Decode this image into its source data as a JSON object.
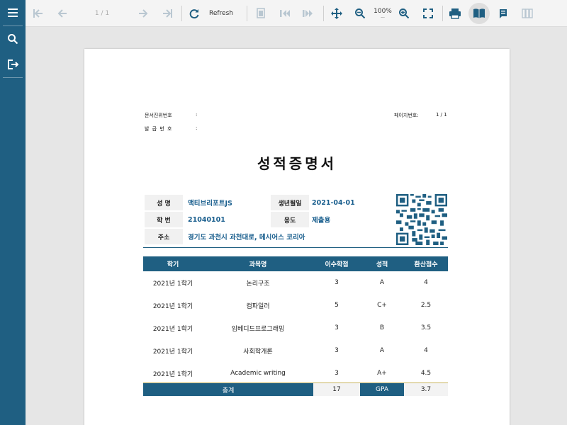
{
  "toolbar": {
    "page_indicator": "1 / 1",
    "refresh_label": "Refresh",
    "zoom_value": "100%",
    "zoom_sub": "..."
  },
  "document": {
    "header": {
      "doc_verify_label": "문서진위번호",
      "doc_verify_colon": ":",
      "issue_no_label": "발 급 번 호",
      "issue_no_colon": ":",
      "page_no_label": "페이지번호:",
      "page_no_value": "1 / 1"
    },
    "title": "성적증명서",
    "student": {
      "name_label": "성 명",
      "name_value": "액티브리포트JS",
      "birth_label": "생년월일",
      "birth_value": "2021-04-01",
      "id_label": "학 번",
      "id_value": "21040101",
      "purpose_label": "용도",
      "purpose_value": "제출용",
      "address_label": "주소",
      "address_value": "경기도 과천시 과천대로, 메시어스 코리아"
    },
    "grades": {
      "headers": [
        "학기",
        "과목명",
        "이수학점",
        "성적",
        "환산점수"
      ],
      "rows": [
        [
          "2021년 1학기",
          "논리구조",
          "3",
          "A",
          "4"
        ],
        [
          "2021년 1학기",
          "컴파일러",
          "5",
          "C+",
          "2.5"
        ],
        [
          "2021년 1학기",
          "임베디드프로그래밍",
          "3",
          "B",
          "3.5"
        ],
        [
          "2021년 1학기",
          "사회학개론",
          "3",
          "A",
          "4"
        ],
        [
          "2021년 1학기",
          "Academic writing",
          "3",
          "A+",
          "4.5"
        ]
      ],
      "total": {
        "label": "총계",
        "credits": "17",
        "gpa_label": "GPA",
        "gpa_value": "3.7"
      }
    }
  },
  "colors": {
    "sidebar": "#1f5f82",
    "accent": "#1a5f8e",
    "toolbar_icon": "#1f5f82",
    "toolbar_icon_disabled": "#b9c7d1"
  }
}
